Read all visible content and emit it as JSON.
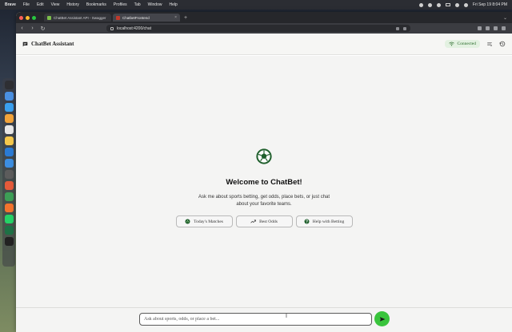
{
  "os": {
    "menu": [
      "Brave",
      "File",
      "Edit",
      "View",
      "History",
      "Bookmarks",
      "Profiles",
      "Tab",
      "Window",
      "Help"
    ],
    "clock": "Fri Sep 19  8:04 PM"
  },
  "browser": {
    "tabs": [
      {
        "title": "ChatBet Assistant API - Swagger",
        "active": false,
        "favicon_color": "#7bbf4a"
      },
      {
        "title": "ChatbetFrontend",
        "active": true,
        "favicon_color": "#c0392b"
      }
    ],
    "url": "localhost:4200/chat"
  },
  "app": {
    "title": "ChatBet Assistant",
    "status": "Connected",
    "colors": {
      "accent": "#39c43c",
      "status_bg": "#e3f1e1",
      "status_text": "#2b6b2b"
    }
  },
  "welcome": {
    "title": "Welcome to ChatBet!",
    "text": "Ask me about sports betting, get odds, place bets, or just chat about your favorite teams."
  },
  "quick_actions": [
    {
      "label": "Today's Matches",
      "icon": "soccer-ball-icon"
    },
    {
      "label": "Best Odds",
      "icon": "trending-up-icon"
    },
    {
      "label": "Help with Betting",
      "icon": "question-icon"
    }
  ],
  "composer": {
    "placeholder": "Ask about sports, odds, or place a bet..."
  }
}
